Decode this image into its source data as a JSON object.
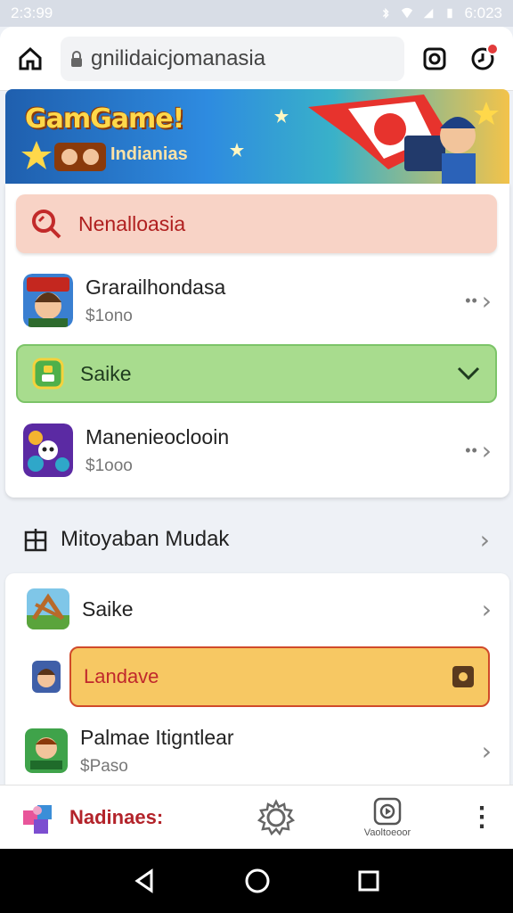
{
  "status_bar": {
    "time": "2:3:99",
    "right_time": "6:023"
  },
  "browser": {
    "url": "gnilidaicjomanasia"
  },
  "banner": {
    "title": "GamGame!",
    "subtitle": "Indianias"
  },
  "highlight_top": {
    "label": "Nenalloasia"
  },
  "games": [
    {
      "name": "Grarailhondasa",
      "price": "$1ono"
    },
    {
      "name": "Manenieoclooin",
      "price": "$1ooo"
    }
  ],
  "saike_highlight": {
    "label": "Saike"
  },
  "section": {
    "title": "Mitoyaban Mudak"
  },
  "section_items": [
    {
      "name": "Saike"
    },
    {
      "name": "Landave"
    },
    {
      "name": "Palmae Itigntlear",
      "price": "$Paso"
    }
  ],
  "bottom_nav": {
    "label": "Nadinaes:",
    "video_label": "Vaoltoeoor"
  },
  "colors": {
    "accent_red": "#b01f1f",
    "accent_green": "#a8dc8e",
    "accent_yellow": "#f7c863"
  }
}
